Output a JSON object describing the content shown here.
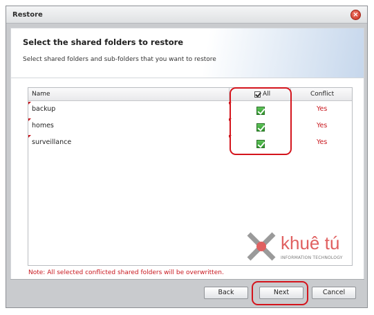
{
  "window": {
    "title": "Restore"
  },
  "header": {
    "heading": "Select the shared folders to restore",
    "subheading": "Select shared folders and sub-folders that you want to restore"
  },
  "table": {
    "columns": {
      "name": "Name",
      "all": "All",
      "conflict": "Conflict"
    },
    "rows": [
      {
        "name": "backup",
        "checked": true,
        "conflict": "Yes"
      },
      {
        "name": "homes",
        "checked": true,
        "conflict": "Yes"
      },
      {
        "name": "surveillance",
        "checked": true,
        "conflict": "Yes"
      }
    ]
  },
  "note": "Note: All selected conflicted shared folders will be overwritten.",
  "watermark": {
    "text": "khuê tú",
    "subtext": "INFORMATION TECHNOLOGY"
  },
  "buttons": {
    "back": "Back",
    "next": "Next",
    "cancel": "Cancel"
  },
  "colors": {
    "accent_red": "#d4141c",
    "check_green": "#3aa836",
    "conflict_red": "#c8161d"
  }
}
